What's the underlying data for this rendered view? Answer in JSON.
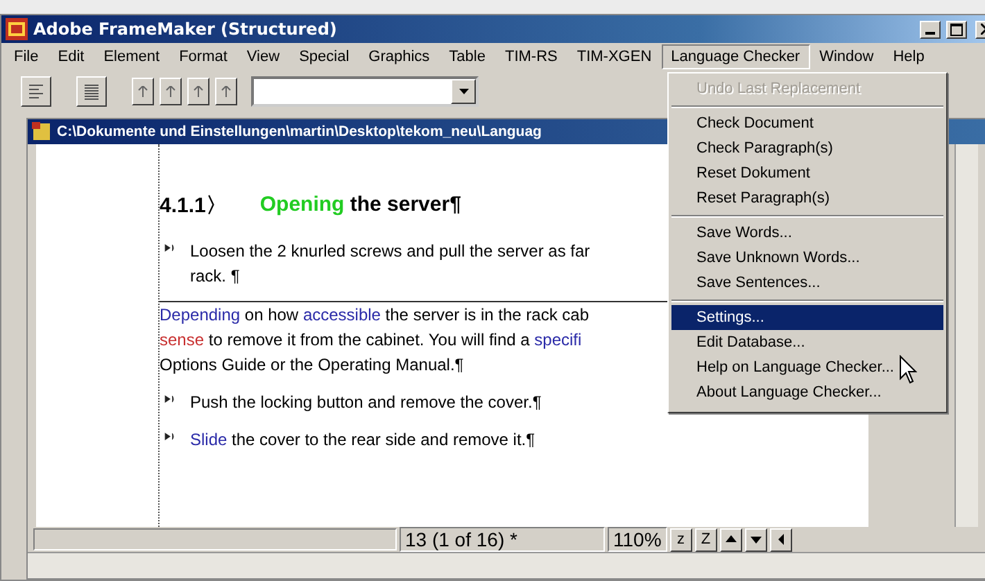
{
  "window": {
    "title": "Adobe FrameMaker (Structured)"
  },
  "menu_bar": [
    {
      "label": "File",
      "selected": false
    },
    {
      "label": "Edit",
      "selected": false
    },
    {
      "label": "Element",
      "selected": false
    },
    {
      "label": "Format",
      "selected": false
    },
    {
      "label": "View",
      "selected": false
    },
    {
      "label": "Special",
      "selected": false
    },
    {
      "label": "Graphics",
      "selected": false
    },
    {
      "label": "Table",
      "selected": false
    },
    {
      "label": "TIM-RS",
      "selected": false
    },
    {
      "label": "TIM-XGEN",
      "selected": false
    },
    {
      "label": "Language Checker",
      "selected": true
    },
    {
      "label": "Window",
      "selected": false
    },
    {
      "label": "Help",
      "selected": false
    }
  ],
  "document": {
    "title": "C:\\Dokumente und Einstellungen\\martin\\Desktop\\tekom_neu\\Languag",
    "heading": {
      "number": "4.1.1〉",
      "segments": [
        {
          "text": "Opening",
          "color": "#22cc22"
        },
        {
          "text": " the server¶"
        }
      ]
    },
    "blocks": [
      {
        "kind": "bullet",
        "lines": [
          [
            {
              "text": "Loosen the 2 knurled screws and pull the server as far"
            }
          ],
          [
            {
              "text": "rack. ¶"
            }
          ]
        ]
      },
      {
        "kind": "body",
        "lines": [
          [
            {
              "text": "Depending",
              "color": "#2a2aa8"
            },
            {
              "text": " on how "
            },
            {
              "text": "accessible",
              "color": "#2a2aa8"
            },
            {
              "text": " the server is in the rack cab"
            }
          ],
          [
            {
              "text": "sense",
              "color": "#c83030"
            },
            {
              "text": " to remove it from the cabinet.  You will find a "
            },
            {
              "text": "specifi",
              "color": "#2a2aa8"
            }
          ],
          [
            {
              "text": "Options Guide or the Operating Manual.¶"
            }
          ]
        ]
      },
      {
        "kind": "bullet",
        "lines": [
          [
            {
              "text": "Push the locking button and remove the cover.¶"
            }
          ]
        ]
      },
      {
        "kind": "bullet",
        "lines": [
          [
            {
              "text": "Slide",
              "color": "#2a2aa8"
            },
            {
              "text": " the cover to the rear side and remove it.¶"
            }
          ]
        ]
      }
    ]
  },
  "status_bar": {
    "page": "13 (1 of 16) *",
    "zoom": "110%",
    "zoom_out": "z",
    "zoom_in": "Z"
  },
  "dropdown_menu": [
    [
      {
        "label": "Undo Last Replacement",
        "disabled": true,
        "selected": false
      }
    ],
    [
      {
        "label": "Check Document",
        "disabled": false,
        "selected": false
      },
      {
        "label": "Check Paragraph(s)",
        "disabled": false,
        "selected": false
      },
      {
        "label": "Reset Dokument",
        "disabled": false,
        "selected": false
      },
      {
        "label": "Reset Paragraph(s)",
        "disabled": false,
        "selected": false
      }
    ],
    [
      {
        "label": "Save Words...",
        "disabled": false,
        "selected": false
      },
      {
        "label": "Save Unknown Words...",
        "disabled": false,
        "selected": false
      },
      {
        "label": "Save Sentences...",
        "disabled": false,
        "selected": false
      }
    ],
    [
      {
        "label": "Settings...",
        "disabled": false,
        "selected": true
      },
      {
        "label": "Edit Database...",
        "disabled": false,
        "selected": false
      },
      {
        "label": "Help on Language Checker...",
        "disabled": false,
        "selected": false
      },
      {
        "label": "About Language Checker...",
        "disabled": false,
        "selected": false
      }
    ]
  ]
}
